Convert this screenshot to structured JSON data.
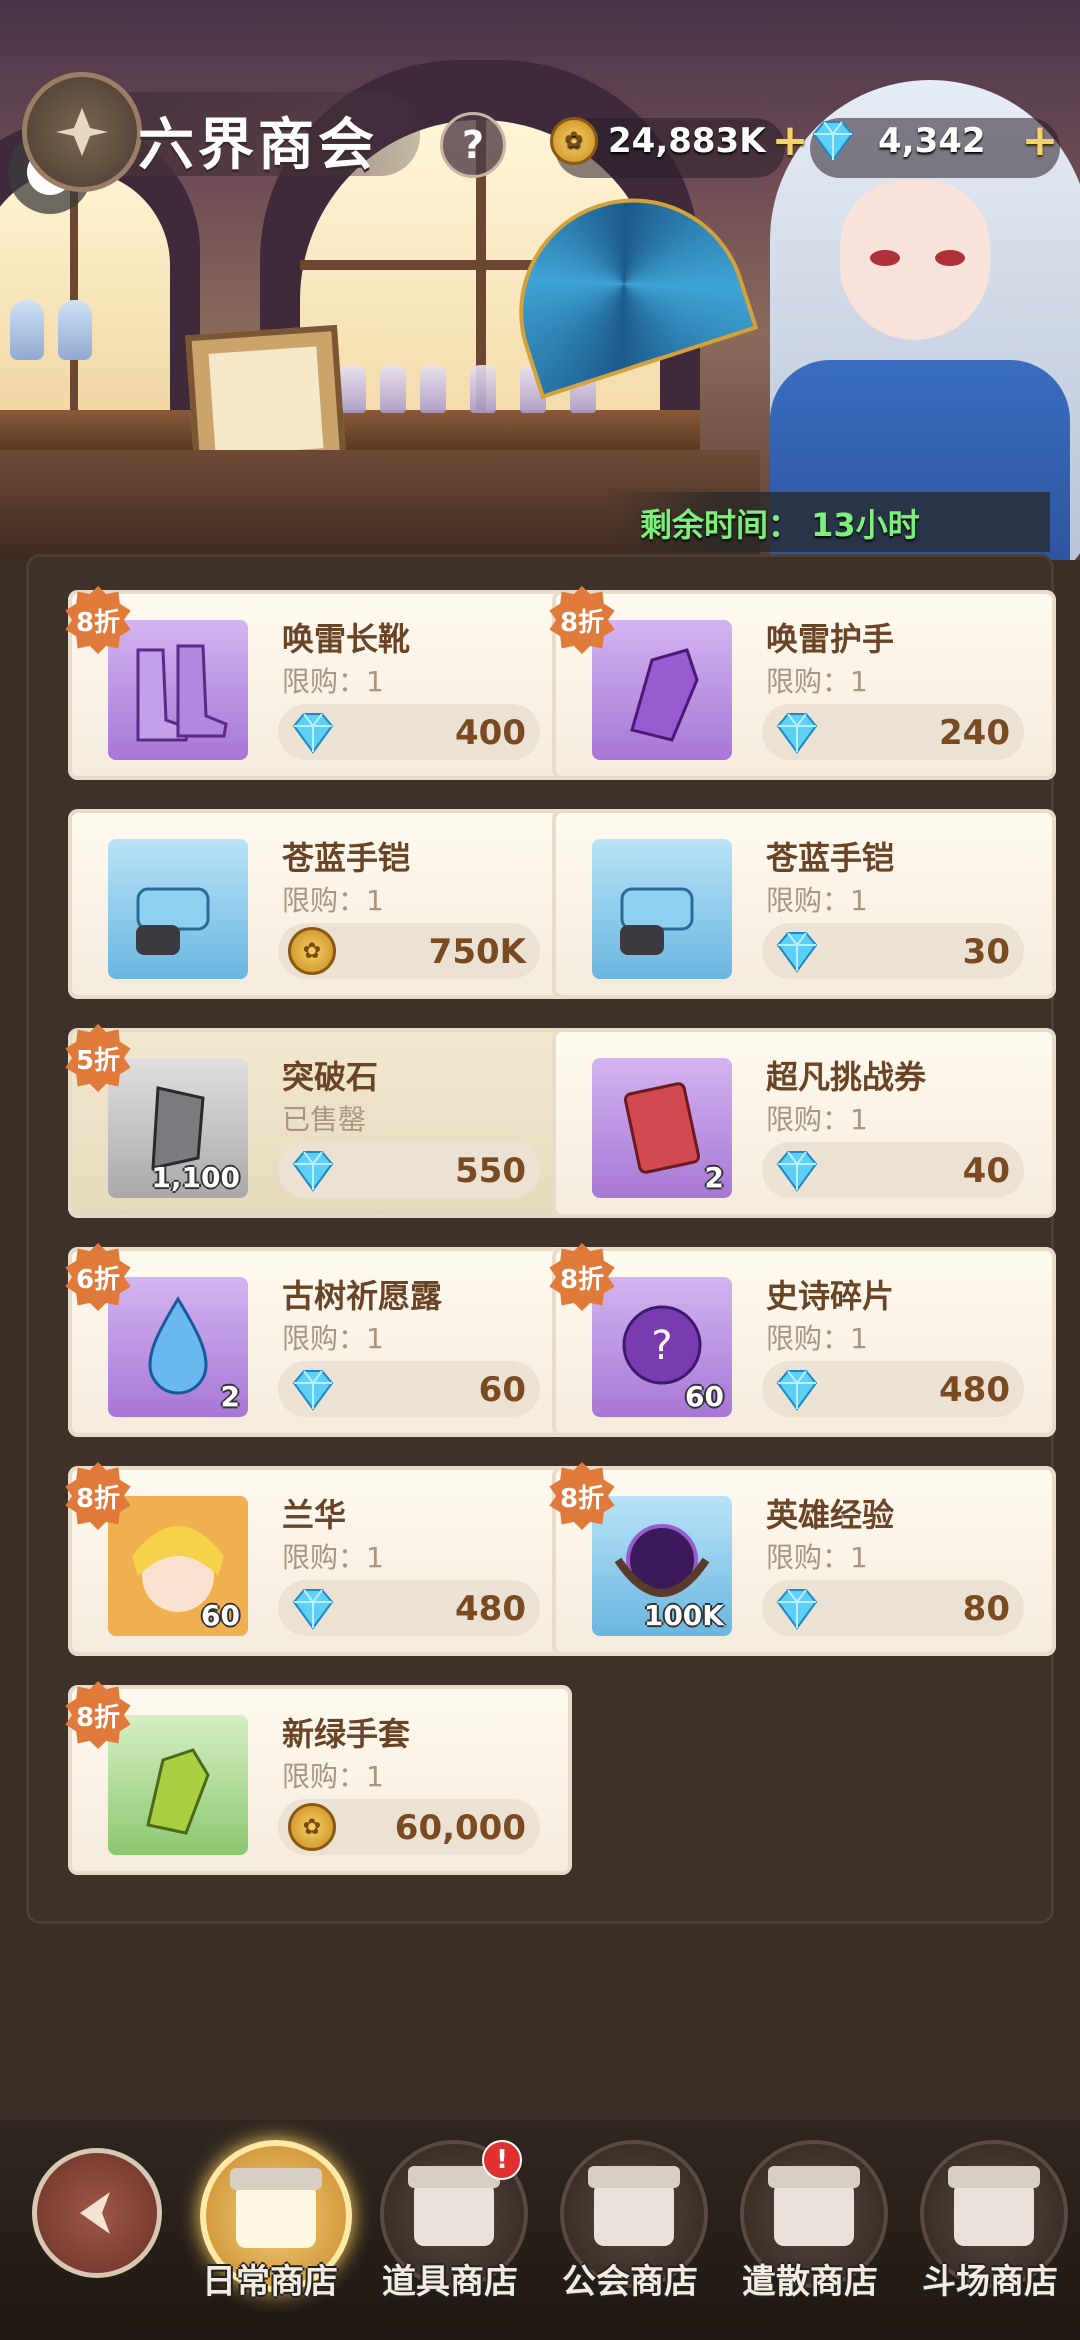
{
  "header": {
    "title": "六界商会",
    "help": "?",
    "gold": "24,883K",
    "gems": "4,342",
    "plus": "+",
    "timer": "剩余时间： 13小时"
  },
  "colors": {
    "discount_badge": "#e07a3a",
    "timer": "#7cf07a",
    "price_text": "#7a4a22",
    "item_name": "#6a4426"
  },
  "items": [
    {
      "name": "唤雷长靴",
      "limit": "限购：1",
      "price": "400",
      "currency": "gem",
      "discount": "8折",
      "icon": "boots-icon",
      "bg": "purple",
      "qty": ""
    },
    {
      "name": "唤雷护手",
      "limit": "限购：1",
      "price": "240",
      "currency": "gem",
      "discount": "8折",
      "icon": "gauntlet-icon",
      "bg": "purple",
      "qty": ""
    },
    {
      "name": "苍蓝手铠",
      "limit": "限购：1",
      "price": "750K",
      "currency": "gold",
      "discount": "",
      "icon": "blue-gauntlet-icon",
      "bg": "blue",
      "qty": ""
    },
    {
      "name": "苍蓝手铠",
      "limit": "限购：1",
      "price": "30",
      "currency": "gem",
      "discount": "",
      "icon": "blue-gauntlet-icon",
      "bg": "blue",
      "qty": ""
    },
    {
      "name": "突破石",
      "limit": "已售罄",
      "price": "550",
      "currency": "gem",
      "discount": "5折",
      "icon": "breakthrough-stone-icon",
      "bg": "grey",
      "qty": "1,100"
    },
    {
      "name": "超凡挑战券",
      "limit": "限购：1",
      "price": "40",
      "currency": "gem",
      "discount": "",
      "icon": "challenge-ticket-icon",
      "bg": "purple",
      "qty": "2"
    },
    {
      "name": "古树祈愿露",
      "limit": "限购：1",
      "price": "60",
      "currency": "gem",
      "discount": "6折",
      "icon": "water-drop-icon",
      "bg": "purple",
      "qty": "2"
    },
    {
      "name": "史诗碎片",
      "limit": "限购：1",
      "price": "480",
      "currency": "gem",
      "discount": "8折",
      "icon": "epic-shard-icon",
      "bg": "purple",
      "qty": "60"
    },
    {
      "name": "兰华",
      "limit": "限购：1",
      "price": "480",
      "currency": "gem",
      "discount": "8折",
      "icon": "hero-portrait-icon",
      "bg": "purple",
      "qty": "60"
    },
    {
      "name": "英雄经验",
      "limit": "限购：1",
      "price": "80",
      "currency": "gem",
      "discount": "8折",
      "icon": "hero-exp-orb-icon",
      "bg": "blue",
      "qty": "100K"
    },
    {
      "name": "新绿手套",
      "limit": "限购：1",
      "price": "60,000",
      "currency": "gold",
      "discount": "8折",
      "icon": "green-glove-icon",
      "bg": "green",
      "qty": ""
    }
  ],
  "nav": {
    "tabs": [
      {
        "label": "日常商店",
        "active": true
      },
      {
        "label": "道具商店",
        "active": false,
        "notify": "!"
      },
      {
        "label": "公会商店",
        "active": false
      },
      {
        "label": "遣散商店",
        "active": false
      },
      {
        "label": "斗场商店",
        "active": false
      }
    ]
  }
}
